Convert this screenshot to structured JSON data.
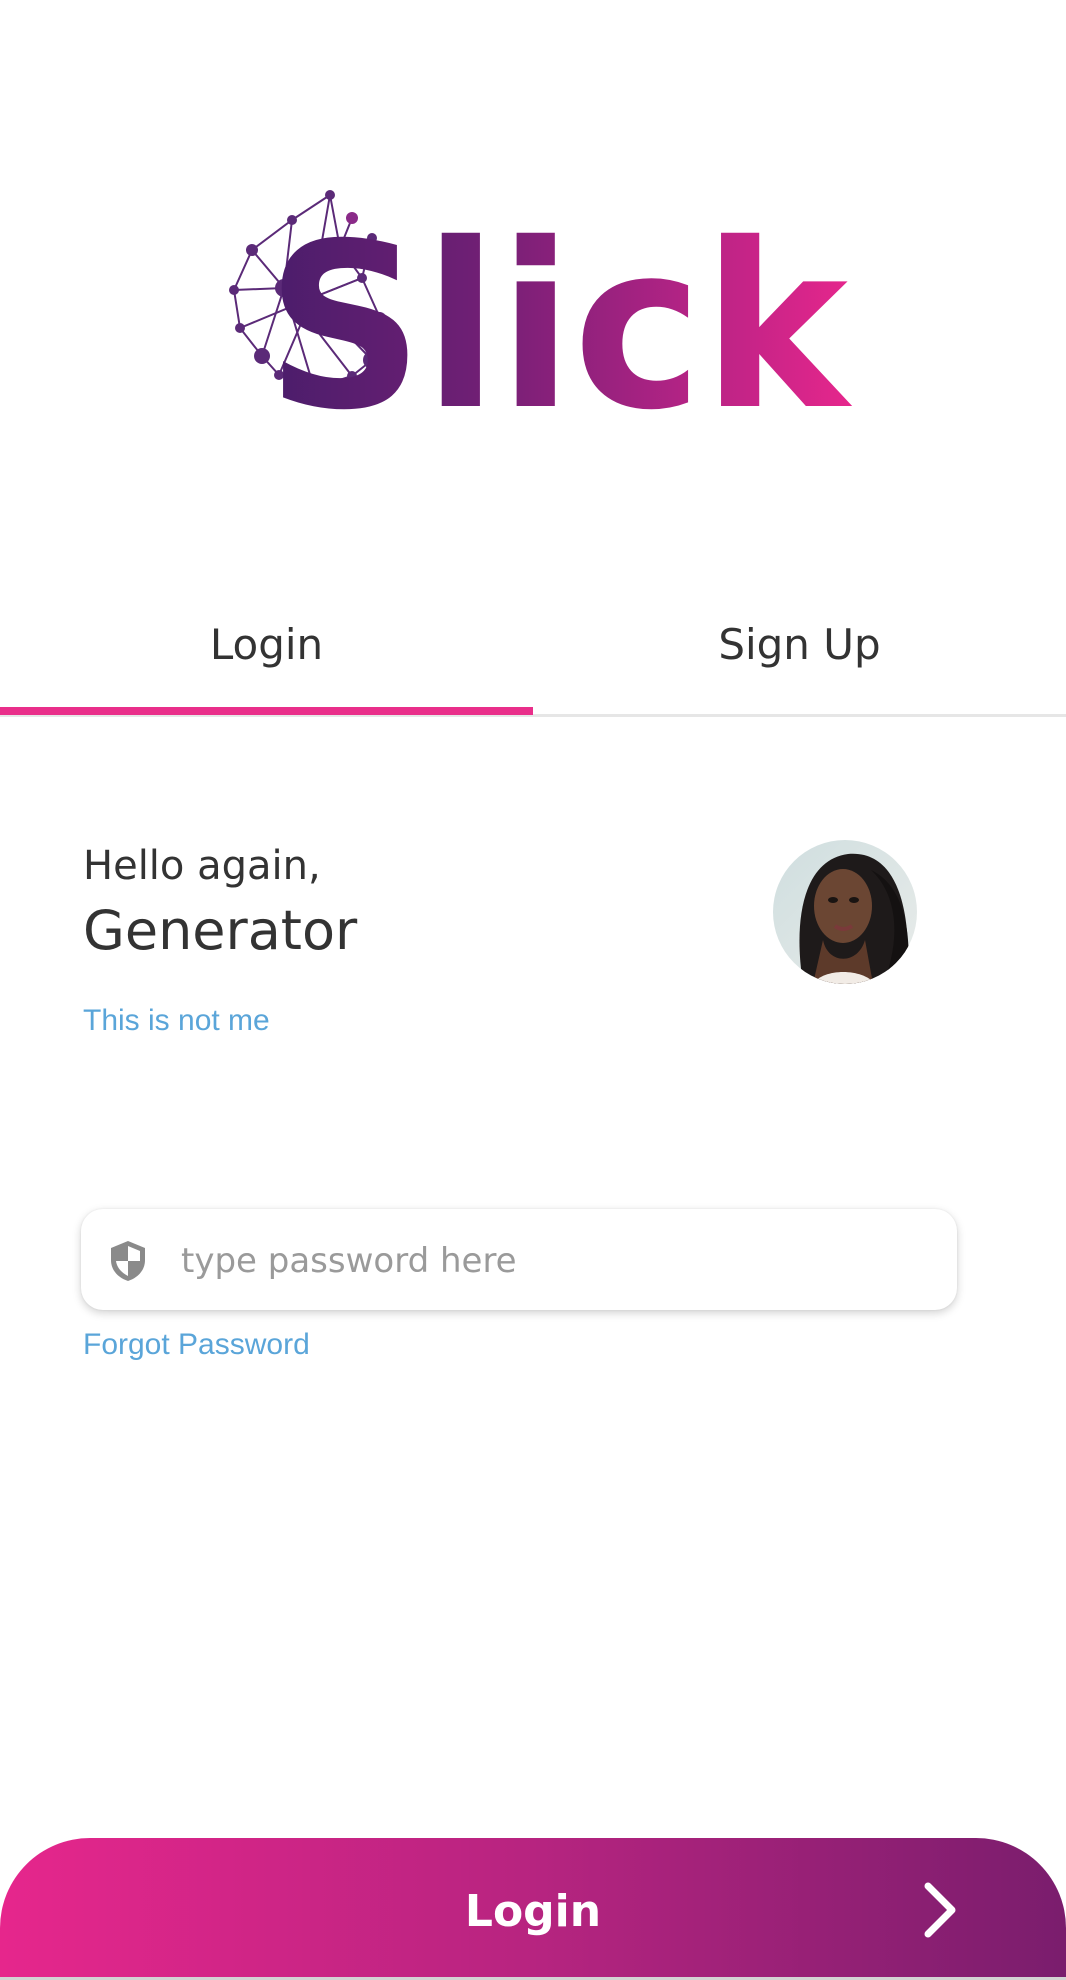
{
  "logo": {
    "text": "Slick",
    "icon": "network-s-logo"
  },
  "tabs": {
    "login_label": "Login",
    "signup_label": "Sign Up",
    "active": "Login"
  },
  "greeting": {
    "hello": "Hello again,",
    "name": "Generator",
    "not_me": "This is not me"
  },
  "avatar": {
    "description_icon": "user-avatar"
  },
  "password": {
    "icon": "shield-icon",
    "placeholder": "type password here",
    "value": ""
  },
  "forgot_password": "Forgot Password",
  "login_button": {
    "label": "Login",
    "icon": "chevron-right-icon"
  },
  "colors": {
    "accent": "#e92e8a",
    "gradient_start": "#e6268c",
    "gradient_end": "#7a1d6d",
    "link": "#5aa5d9",
    "logo_dark": "#4a1d6b"
  }
}
